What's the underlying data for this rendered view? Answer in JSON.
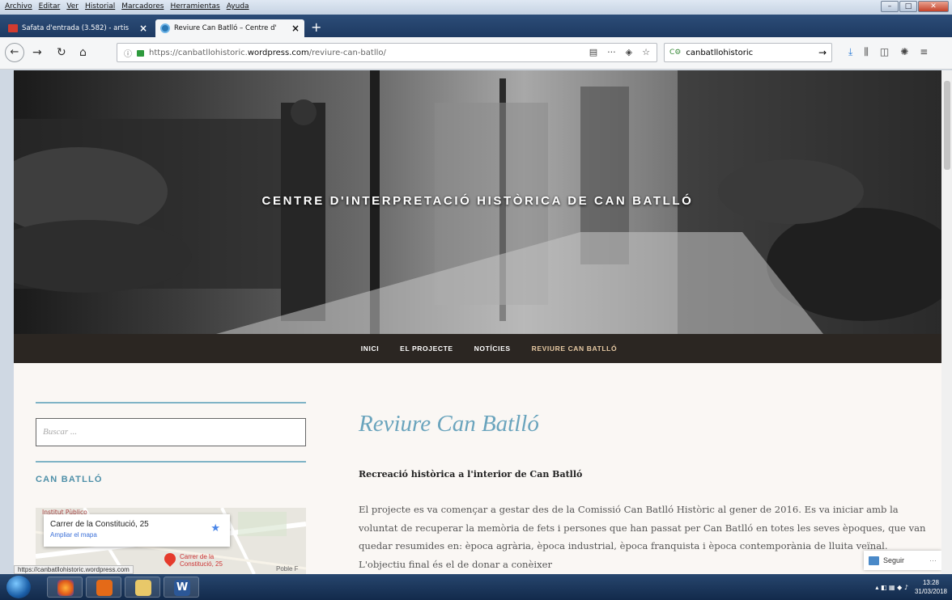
{
  "menubar": {
    "items": [
      "Archivo",
      "Editar",
      "Ver",
      "Historial",
      "Marcadores",
      "Herramientas",
      "Ayuda"
    ]
  },
  "tabs": [
    {
      "title": "Safata d'entrada (3.582) - artis",
      "icon": "gmail-icon"
    },
    {
      "title": "Reviure Can Batlló – Centre d'",
      "icon": "wordpress-icon"
    }
  ],
  "navbar": {
    "url_prefix": "https://canbatllohistoric.",
    "url_domain": "wordpress.com",
    "url_path": "/reviure-can-batllo/",
    "search_value": "canbatllohistoric"
  },
  "site": {
    "title": "CENTRE D'INTERPRETACIÓ HISTÒRICA DE CAN BATLLÓ",
    "nav": [
      "INICI",
      "EL PROJECTE",
      "NOTÍCIES",
      "REVIURE CAN BATLLÓ"
    ]
  },
  "sidebar": {
    "search_placeholder": "Buscar ...",
    "widget_title": "CAN BATLLÓ",
    "map": {
      "address": "Carrer de la Constitució, 25",
      "enlarge": "Ampliar el mapa",
      "pin_label_1": "Carrer de la",
      "pin_label_2": "Constitució, 25",
      "poi": "Institut Pùblico",
      "area": "Poble F"
    }
  },
  "content": {
    "title": "Reviure Can Batlló",
    "lead": "Recreació històrica a l'interior de Can Batlló",
    "body": "El projecte es va començar a gestar des de la Comissió Can Batlló Històric al gener de 2016. Es va iniciar amb la voluntat de recuperar la memòria de fets i persones que han passat per Can Batlló en totes les seves èpoques, que van quedar resumides en: època agrària, època industrial, època franquista i època contemporània de lluita veïnal. L'objectiu final és el de donar a conèixer"
  },
  "follow": {
    "label": "Seguir",
    "more": "···"
  },
  "status_url": "https://canbatllohistoric.wordpress.com",
  "taskbar": {
    "time": "13:28",
    "date": "31/03/2018"
  },
  "colors": {
    "accent": "#6aa4bd",
    "nav_bg": "#2b2622",
    "nav_current": "#e6c9a3"
  }
}
